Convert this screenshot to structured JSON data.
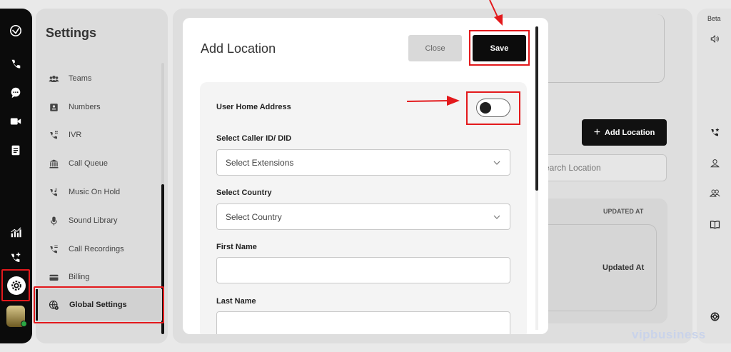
{
  "settings": {
    "title": "Settings",
    "menu": [
      {
        "label": "Teams",
        "icon": "teams-icon"
      },
      {
        "label": "Numbers",
        "icon": "numbers-icon"
      },
      {
        "label": "IVR",
        "icon": "ivr-icon"
      },
      {
        "label": "Call Queue",
        "icon": "call-queue-icon"
      },
      {
        "label": "Music On Hold",
        "icon": "music-on-hold-icon"
      },
      {
        "label": "Sound Library",
        "icon": "microphone-icon"
      },
      {
        "label": "Call Recordings",
        "icon": "call-recordings-icon"
      },
      {
        "label": "Billing",
        "icon": "billing-card-icon"
      },
      {
        "label": "Global Settings",
        "icon": "globe-gear-icon"
      }
    ]
  },
  "modal": {
    "title": "Add Location",
    "close_label": "Close",
    "save_label": "Save",
    "user_home_address_label": "User Home Address",
    "user_home_address_on": false,
    "caller_id_label": "Select Caller ID/ DID",
    "caller_id_value": "Select Extensions",
    "country_label": "Select Country",
    "country_value": "Select Country",
    "first_name_label": "First Name",
    "first_name_value": "",
    "last_name_label": "Last Name",
    "last_name_value": ""
  },
  "background": {
    "add_location_label": "Add Location",
    "search_placeholder": "earch Location",
    "table_header": "UPDATED AT",
    "table_cell": "Updated At"
  },
  "right_rail": {
    "beta_label": "Beta"
  },
  "watermark": "vipbusiness",
  "colors": {
    "highlight": "#e3191c",
    "primary": "#0c0c0c",
    "rail": "#0b0b0b"
  }
}
